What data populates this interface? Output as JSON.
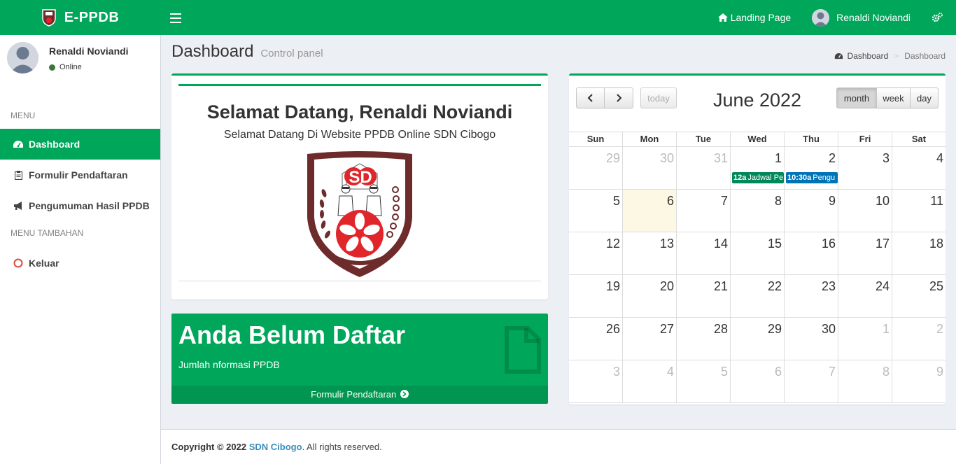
{
  "brand": {
    "name": "E-PPDB"
  },
  "nav": {
    "landing_label": "Landing Page",
    "user_name": "Renaldi Noviandi"
  },
  "sidebar": {
    "user_name": "Renaldi Noviandi",
    "status": "Online",
    "menu_header": "MENU",
    "menu_extra_header": "MENU TAMBAHAN",
    "items": [
      {
        "label": "Dashboard",
        "icon": "dashboard-icon",
        "active": true
      },
      {
        "label": "Formulir Pendaftaran",
        "icon": "clipboard-icon"
      },
      {
        "label": "Pengumuman Hasil PPDB",
        "icon": "bullhorn-icon"
      },
      {
        "label": "Keluar",
        "icon": "circle-icon"
      }
    ]
  },
  "content": {
    "title": "Dashboard",
    "subtitle": "Control panel"
  },
  "breadcrumb": {
    "home": "Dashboard",
    "current": "Dashboard"
  },
  "welcome": {
    "title": "Selamat Datang, Renaldi Noviandi",
    "subtitle": "Selamat Datang Di Website PPDB Online SDN Cibogo",
    "logo_text": "SD"
  },
  "status_box": {
    "title": "Anda Belum Daftar",
    "text": "Jumlah nformasi PPDB",
    "footer": "Formulir Pendaftaran"
  },
  "calendar": {
    "title": "June 2022",
    "today_label": "today",
    "views": [
      "month",
      "week",
      "day"
    ],
    "active_view": "month",
    "weekdays": [
      "Sun",
      "Mon",
      "Tue",
      "Wed",
      "Thu",
      "Fri",
      "Sat"
    ],
    "weeks": [
      [
        {
          "d": "29",
          "o": 1
        },
        {
          "d": "30",
          "o": 1
        },
        {
          "d": "31",
          "o": 1
        },
        {
          "d": "1",
          "o": 0
        },
        {
          "d": "2",
          "o": 0
        },
        {
          "d": "3",
          "o": 0
        },
        {
          "d": "4",
          "o": 0
        }
      ],
      [
        {
          "d": "5",
          "o": 0
        },
        {
          "d": "6",
          "o": 0,
          "today": 1
        },
        {
          "d": "7",
          "o": 0
        },
        {
          "d": "8",
          "o": 0
        },
        {
          "d": "9",
          "o": 0
        },
        {
          "d": "10",
          "o": 0
        },
        {
          "d": "11",
          "o": 0
        }
      ],
      [
        {
          "d": "12",
          "o": 0
        },
        {
          "d": "13",
          "o": 0
        },
        {
          "d": "14",
          "o": 0
        },
        {
          "d": "15",
          "o": 0
        },
        {
          "d": "16",
          "o": 0
        },
        {
          "d": "17",
          "o": 0
        },
        {
          "d": "18",
          "o": 0
        }
      ],
      [
        {
          "d": "19",
          "o": 0
        },
        {
          "d": "20",
          "o": 0
        },
        {
          "d": "21",
          "o": 0
        },
        {
          "d": "22",
          "o": 0
        },
        {
          "d": "23",
          "o": 0
        },
        {
          "d": "24",
          "o": 0
        },
        {
          "d": "25",
          "o": 0
        }
      ],
      [
        {
          "d": "26",
          "o": 0
        },
        {
          "d": "27",
          "o": 0
        },
        {
          "d": "28",
          "o": 0
        },
        {
          "d": "29",
          "o": 0
        },
        {
          "d": "30",
          "o": 0
        },
        {
          "d": "1",
          "o": 1
        },
        {
          "d": "2",
          "o": 1
        }
      ],
      [
        {
          "d": "3",
          "o": 1
        },
        {
          "d": "4",
          "o": 1
        },
        {
          "d": "5",
          "o": 1
        },
        {
          "d": "6",
          "o": 1
        },
        {
          "d": "7",
          "o": 1
        },
        {
          "d": "8",
          "o": 1
        },
        {
          "d": "9",
          "o": 1
        }
      ]
    ],
    "events": [
      {
        "week": 0,
        "day": 3,
        "time": "12a",
        "title": "Jadwal Pe",
        "color": "#00875a"
      },
      {
        "week": 0,
        "day": 4,
        "time": "10:30a",
        "title": "Pengu",
        "color": "#0073b7"
      }
    ]
  },
  "footer": {
    "prefix": "Copyright © 2022 ",
    "org": "SDN Cibogo",
    "suffix": ". All rights reserved."
  },
  "colors": {
    "accent": "#00a65a",
    "link": "#3c8dbc",
    "logo_maroon": "#6e2b2b",
    "logo_red": "#e0262b"
  }
}
